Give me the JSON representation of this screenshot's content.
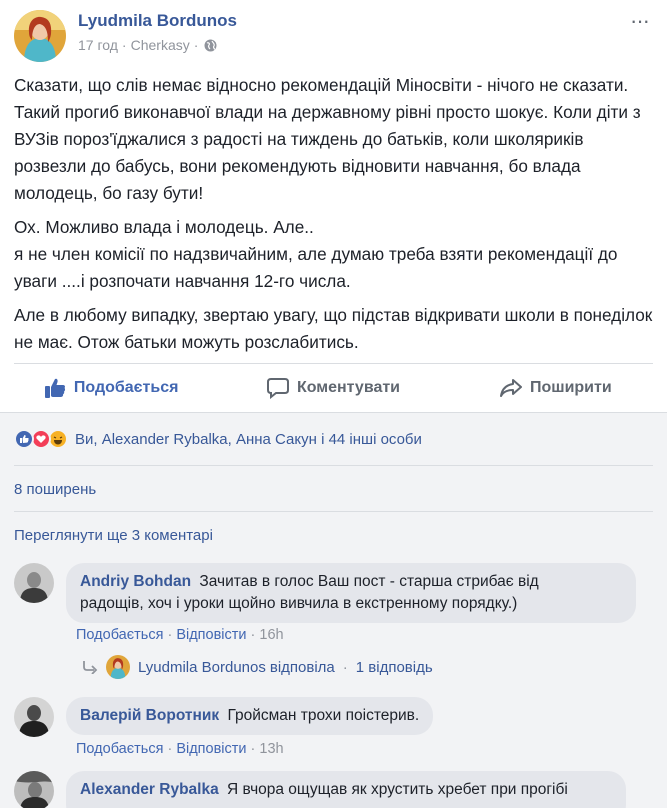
{
  "post": {
    "author": "Lyudmila Bordunos",
    "time": "17 год",
    "location": "Cherkasy",
    "separator": "·",
    "more_label": "···",
    "paragraphs": [
      "Сказати, що слів немає відносно рекомендацій Міносвіти - нічого не сказати. Такий прогиб виконавчої влади на державному рівні просто шокує. Коли діти з ВУЗів пороз'їджалися з радості на тиждень до батьків, коли школяриків розвезли до бабусь, вони рекомендують відновити навчання, бо влада молодець, бо газу бути!",
      "Ох. Можливо влада і молодець. Але..",
      "я не член комісії по надзвичайним, але думаю треба взяти рекомендації до уваги ....і розпочати навчання 12-го числа.",
      "Але в любому випадку, звертаю увагу, що підстав відкривати школи в понеділок не має. Отож батьки можуть розслабитись."
    ],
    "icons": {
      "globe": "globe-icon",
      "more": "more-icon"
    }
  },
  "actions": {
    "like": "Подобається",
    "comment": "Коментувати",
    "share": "Поширити"
  },
  "reactions": {
    "types": [
      "like",
      "love",
      "haha"
    ],
    "summary": "Ви, Alexander Rybalka, Анна Сакун і 44 інші особи"
  },
  "shares": "8 поширень",
  "more_comments": "Переглянути ще 3 коментарі",
  "comments": [
    {
      "name": "Andriy Bohdan",
      "text": "Зачитав в голос Ваш пост - старша стрибає від",
      "text2": "радощів, хоч і уроки щойно вивчила в екстренному порядку.)",
      "like": "Подобається",
      "reply": "Відповісти",
      "time": "16h",
      "reply_summary": {
        "author": "Lyudmila Bordunos",
        "verb": "відповіла",
        "count": "1 відповідь"
      }
    },
    {
      "name": "Валерій Воротник",
      "text": "Гройсман трохи поістерив.",
      "like": "Подобається",
      "reply": "Відповісти",
      "time": "13h"
    },
    {
      "name": "Alexander Rybalka",
      "text": "Я вчора ощущав як хрустить хребет при прогібі"
    }
  ],
  "colors": {
    "link": "#385898",
    "like_active": "#4267b2",
    "muted": "#90949c",
    "bubble": "#e4e6eb",
    "comments_bg": "#f2f3f5"
  }
}
